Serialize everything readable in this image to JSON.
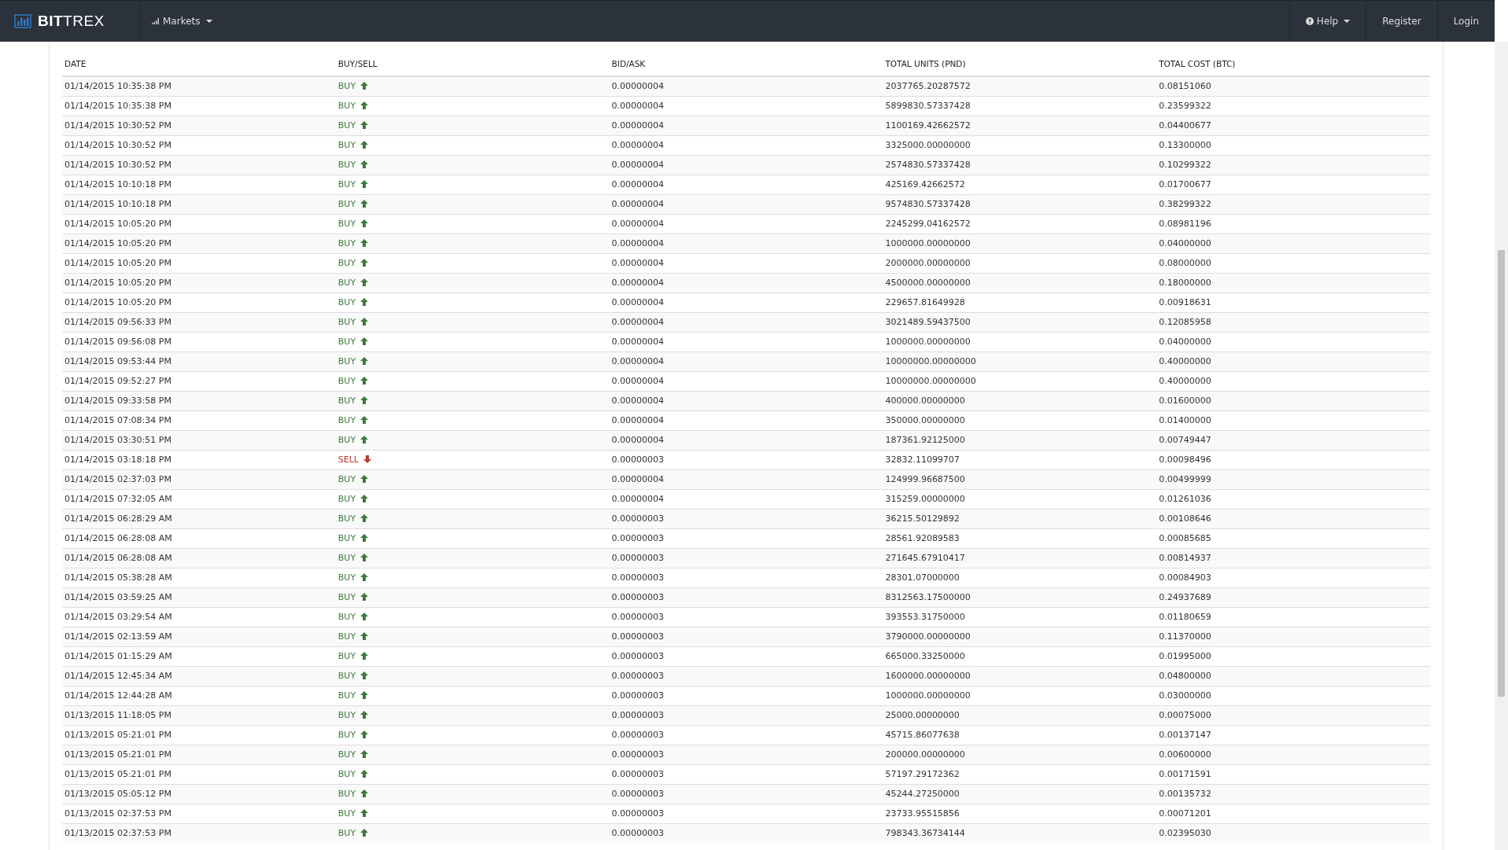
{
  "navbar": {
    "brand": "**BIT**TREX",
    "menu": [
      {
        "label": "Markets",
        "kind": "dropdown"
      }
    ],
    "right": [
      {
        "label": "Help",
        "kind": "dropdown"
      },
      {
        "label": "Register",
        "kind": "link"
      },
      {
        "label": "Login",
        "kind": "link"
      }
    ]
  },
  "table": {
    "columns": [
      "DATE",
      "BUY/SELL",
      "BID/ASK",
      "TOTAL UNITS (PND)",
      "TOTAL COST (BTC)"
    ],
    "rows": [
      {
        "date": "01/14/2015 10:35:38 PM",
        "kind": "buy",
        "type": "BUY",
        "price": "0.00000004",
        "units": "2037765.20287572",
        "cost": "0.08151060"
      },
      {
        "date": "01/14/2015 10:35:38 PM",
        "kind": "buy",
        "type": "BUY",
        "price": "0.00000004",
        "units": "5899830.57337428",
        "cost": "0.23599322"
      },
      {
        "date": "01/14/2015 10:30:52 PM",
        "kind": "buy",
        "type": "BUY",
        "price": "0.00000004",
        "units": "1100169.42662572",
        "cost": "0.04400677"
      },
      {
        "date": "01/14/2015 10:30:52 PM",
        "kind": "buy",
        "type": "BUY",
        "price": "0.00000004",
        "units": "3325000.00000000",
        "cost": "0.13300000"
      },
      {
        "date": "01/14/2015 10:30:52 PM",
        "kind": "buy",
        "type": "BUY",
        "price": "0.00000004",
        "units": "2574830.57337428",
        "cost": "0.10299322"
      },
      {
        "date": "01/14/2015 10:10:18 PM",
        "kind": "buy",
        "type": "BUY",
        "price": "0.00000004",
        "units": "425169.42662572",
        "cost": "0.01700677"
      },
      {
        "date": "01/14/2015 10:10:18 PM",
        "kind": "buy",
        "type": "BUY",
        "price": "0.00000004",
        "units": "9574830.57337428",
        "cost": "0.38299322"
      },
      {
        "date": "01/14/2015 10:05:20 PM",
        "kind": "buy",
        "type": "BUY",
        "price": "0.00000004",
        "units": "2245299.04162572",
        "cost": "0.08981196"
      },
      {
        "date": "01/14/2015 10:05:20 PM",
        "kind": "buy",
        "type": "BUY",
        "price": "0.00000004",
        "units": "1000000.00000000",
        "cost": "0.04000000"
      },
      {
        "date": "01/14/2015 10:05:20 PM",
        "kind": "buy",
        "type": "BUY",
        "price": "0.00000004",
        "units": "2000000.00000000",
        "cost": "0.08000000"
      },
      {
        "date": "01/14/2015 10:05:20 PM",
        "kind": "buy",
        "type": "BUY",
        "price": "0.00000004",
        "units": "4500000.00000000",
        "cost": "0.18000000"
      },
      {
        "date": "01/14/2015 10:05:20 PM",
        "kind": "buy",
        "type": "BUY",
        "price": "0.00000004",
        "units": "229657.81649928",
        "cost": "0.00918631"
      },
      {
        "date": "01/14/2015 09:56:33 PM",
        "kind": "buy",
        "type": "BUY",
        "price": "0.00000004",
        "units": "3021489.59437500",
        "cost": "0.12085958"
      },
      {
        "date": "01/14/2015 09:56:08 PM",
        "kind": "buy",
        "type": "BUY",
        "price": "0.00000004",
        "units": "1000000.00000000",
        "cost": "0.04000000"
      },
      {
        "date": "01/14/2015 09:53:44 PM",
        "kind": "buy",
        "type": "BUY",
        "price": "0.00000004",
        "units": "10000000.00000000",
        "cost": "0.40000000"
      },
      {
        "date": "01/14/2015 09:52:27 PM",
        "kind": "buy",
        "type": "BUY",
        "price": "0.00000004",
        "units": "10000000.00000000",
        "cost": "0.40000000"
      },
      {
        "date": "01/14/2015 09:33:58 PM",
        "kind": "buy",
        "type": "BUY",
        "price": "0.00000004",
        "units": "400000.00000000",
        "cost": "0.01600000"
      },
      {
        "date": "01/14/2015 07:08:34 PM",
        "kind": "buy",
        "type": "BUY",
        "price": "0.00000004",
        "units": "350000.00000000",
        "cost": "0.01400000"
      },
      {
        "date": "01/14/2015 03:30:51 PM",
        "kind": "buy",
        "type": "BUY",
        "price": "0.00000004",
        "units": "187361.92125000",
        "cost": "0.00749447"
      },
      {
        "date": "01/14/2015 03:18:18 PM",
        "kind": "sell",
        "type": "SELL",
        "price": "0.00000003",
        "units": "32832.11099707",
        "cost": "0.00098496"
      },
      {
        "date": "01/14/2015 02:37:03 PM",
        "kind": "buy",
        "type": "BUY",
        "price": "0.00000004",
        "units": "124999.96687500",
        "cost": "0.00499999"
      },
      {
        "date": "01/14/2015 07:32:05 AM",
        "kind": "buy",
        "type": "BUY",
        "price": "0.00000004",
        "units": "315259.00000000",
        "cost": "0.01261036"
      },
      {
        "date": "01/14/2015 06:28:29 AM",
        "kind": "buy",
        "type": "BUY",
        "price": "0.00000003",
        "units": "36215.50129892",
        "cost": "0.00108646"
      },
      {
        "date": "01/14/2015 06:28:08 AM",
        "kind": "buy",
        "type": "BUY",
        "price": "0.00000003",
        "units": "28561.92089583",
        "cost": "0.00085685"
      },
      {
        "date": "01/14/2015 06:28:08 AM",
        "kind": "buy",
        "type": "BUY",
        "price": "0.00000003",
        "units": "271645.67910417",
        "cost": "0.00814937"
      },
      {
        "date": "01/14/2015 05:38:28 AM",
        "kind": "buy",
        "type": "BUY",
        "price": "0.00000003",
        "units": "28301.07000000",
        "cost": "0.00084903"
      },
      {
        "date": "01/14/2015 03:59:25 AM",
        "kind": "buy",
        "type": "BUY",
        "price": "0.00000003",
        "units": "8312563.17500000",
        "cost": "0.24937689"
      },
      {
        "date": "01/14/2015 03:29:54 AM",
        "kind": "buy",
        "type": "BUY",
        "price": "0.00000003",
        "units": "393553.31750000",
        "cost": "0.01180659"
      },
      {
        "date": "01/14/2015 02:13:59 AM",
        "kind": "buy",
        "type": "BUY",
        "price": "0.00000003",
        "units": "3790000.00000000",
        "cost": "0.11370000"
      },
      {
        "date": "01/14/2015 01:15:29 AM",
        "kind": "buy",
        "type": "BUY",
        "price": "0.00000003",
        "units": "665000.33250000",
        "cost": "0.01995000"
      },
      {
        "date": "01/14/2015 12:45:34 AM",
        "kind": "buy",
        "type": "BUY",
        "price": "0.00000003",
        "units": "1600000.00000000",
        "cost": "0.04800000"
      },
      {
        "date": "01/14/2015 12:44:28 AM",
        "kind": "buy",
        "type": "BUY",
        "price": "0.00000003",
        "units": "1000000.00000000",
        "cost": "0.03000000"
      },
      {
        "date": "01/13/2015 11:18:05 PM",
        "kind": "buy",
        "type": "BUY",
        "price": "0.00000003",
        "units": "25000.00000000",
        "cost": "0.00075000"
      },
      {
        "date": "01/13/2015 05:21:01 PM",
        "kind": "buy",
        "type": "BUY",
        "price": "0.00000003",
        "units": "45715.86077638",
        "cost": "0.00137147"
      },
      {
        "date": "01/13/2015 05:21:01 PM",
        "kind": "buy",
        "type": "BUY",
        "price": "0.00000003",
        "units": "200000.00000000",
        "cost": "0.00600000"
      },
      {
        "date": "01/13/2015 05:21:01 PM",
        "kind": "buy",
        "type": "BUY",
        "price": "0.00000003",
        "units": "57197.29172362",
        "cost": "0.00171591"
      },
      {
        "date": "01/13/2015 05:05:12 PM",
        "kind": "buy",
        "type": "BUY",
        "price": "0.00000003",
        "units": "45244.27250000",
        "cost": "0.00135732"
      },
      {
        "date": "01/13/2015 02:37:53 PM",
        "kind": "buy",
        "type": "BUY",
        "price": "0.00000003",
        "units": "23733.95515856",
        "cost": "0.00071201"
      },
      {
        "date": "01/13/2015 02:37:53 PM",
        "kind": "buy",
        "type": "BUY",
        "price": "0.00000003",
        "units": "798343.36734144",
        "cost": "0.02395030"
      }
    ]
  }
}
